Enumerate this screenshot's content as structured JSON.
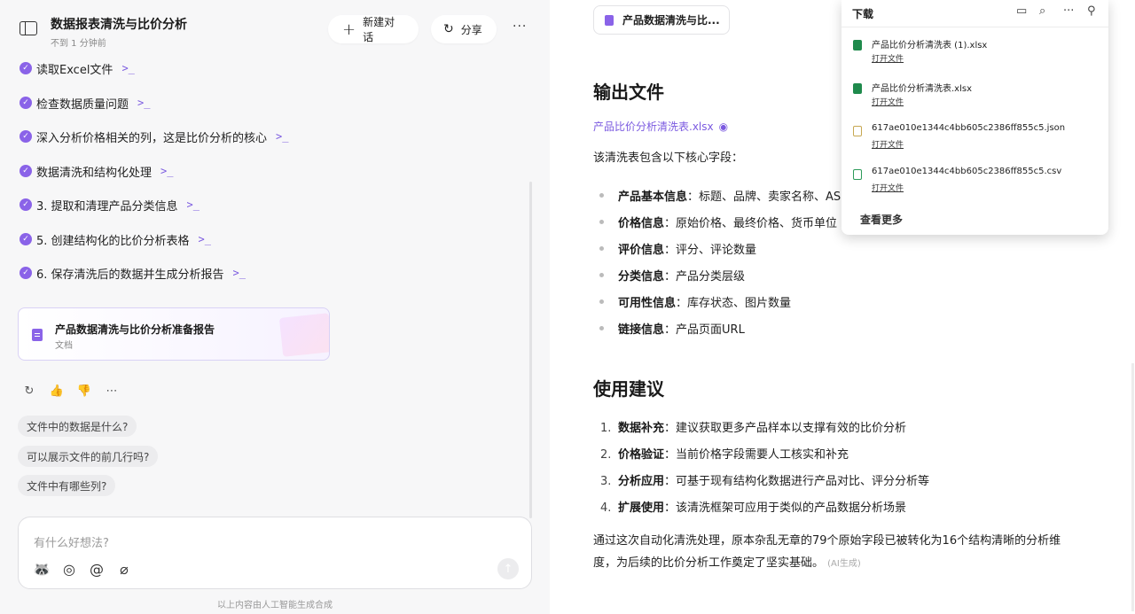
{
  "header": {
    "title": "数据报表清洗与比价分析",
    "subtitle": "不到 1 分钟前",
    "new_chat_label": "新建对话",
    "share_label": "分享"
  },
  "steps": [
    "读取Excel文件",
    "检查数据质量问题",
    "深入分析价格相关的列，这是比价分析的核心",
    "数据清洗和结构化处理",
    "3. 提取和清理产品分类信息",
    "5. 创建结构化的比价分析表格",
    "6. 保存清洗后的数据并生成分析报告"
  ],
  "doc_card": {
    "title": "产品数据清洗与比价分析准备报告",
    "type": "文档"
  },
  "suggestions": [
    "文件中的数据是什么?",
    "可以展示文件的前几行吗?",
    "文件中有哪些列?"
  ],
  "composer": {
    "placeholder": "有什么好想法?"
  },
  "footer_note": "以上内容由人工智能生成合成",
  "right": {
    "tab_title": "产品数据清洗与比...",
    "section1_title": "输出文件",
    "file_link": "产品比价分析清洗表.xlsx",
    "intro": "该清洗表包含以下核心字段：",
    "fields": [
      {
        "label": "产品基本信息",
        "text": "：标题、品牌、卖家名称、AS"
      },
      {
        "label": "价格信息",
        "text": "：原始价格、最终价格、货币单位"
      },
      {
        "label": "评价信息",
        "text": "：评分、评论数量"
      },
      {
        "label": "分类信息",
        "text": "：产品分类层级"
      },
      {
        "label": "可用性信息",
        "text": "：库存状态、图片数量"
      },
      {
        "label": "链接信息",
        "text": "：产品页面URL"
      }
    ],
    "section2_title": "使用建议",
    "suggestions": [
      {
        "n": "1.",
        "label": "数据补充",
        "text": "：建议获取更多产品样本以支撑有效的比价分析"
      },
      {
        "n": "2.",
        "label": "价格验证",
        "text": "：当前价格字段需要人工核实和补充"
      },
      {
        "n": "3.",
        "label": "分析应用",
        "text": "：可基于现有结构化数据进行产品对比、评分分析等"
      },
      {
        "n": "4.",
        "label": "扩展使用",
        "text": "：该清洗框架可应用于类似的产品数据分析场景"
      }
    ],
    "conclusion_line1": "通过这次自动化清洗处理，原本杂乱无章的79个原始字段已被转化为16个结构清晰的分析维",
    "conclusion_line2": "度，为后续的比价分析工作奠定了坚实基础。",
    "ai_tag": "(AI生成)"
  },
  "downloads": {
    "title": "下载",
    "open_label": "打开文件",
    "more_label": "查看更多",
    "files": [
      {
        "name": "产品比价分析清洗表 (1).xlsx",
        "kind": "xlsx"
      },
      {
        "name": "产品比价分析清洗表.xlsx",
        "kind": "xlsx"
      },
      {
        "name": "617ae010e1344c4bb605c2386ff855c5.json",
        "kind": "json"
      },
      {
        "name": "617ae010e1344c4bb605c2386ff855c5.csv",
        "kind": "csv"
      }
    ]
  }
}
